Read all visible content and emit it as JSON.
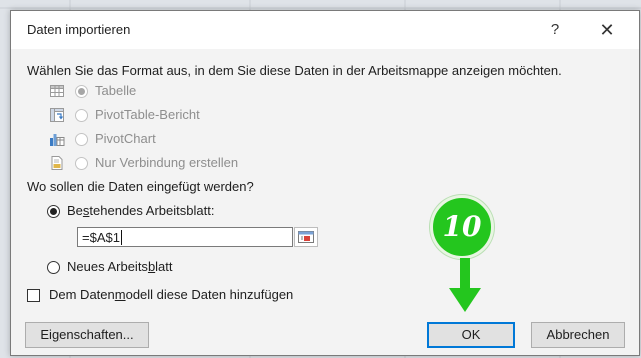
{
  "dialog": {
    "title": "Daten importieren",
    "help_glyph": "?",
    "close_glyph": "✕",
    "prompt_format": "Wählen Sie das Format aus, in dem Sie diese Daten in der Arbeitsmappe anzeigen möchten.",
    "format_options": [
      {
        "label": "Tabelle",
        "icon": "table-icon",
        "selected": true,
        "enabled": false
      },
      {
        "label": "PivotTable-Bericht",
        "icon": "pivottable-icon",
        "selected": false,
        "enabled": false
      },
      {
        "label": "PivotChart",
        "icon": "pivotchart-icon",
        "selected": false,
        "enabled": false
      },
      {
        "label": "Nur Verbindung erstellen",
        "icon": "connection-icon",
        "selected": false,
        "enabled": false
      }
    ],
    "prompt_location": "Wo sollen die Daten eingefügt werden?",
    "existing_sheet": {
      "pre": "Be",
      "ul": "s",
      "post": "tehendes Arbeitsblatt:",
      "selected": true
    },
    "range_value": "=$A$1",
    "new_sheet": {
      "pre": "Neues Arbeits",
      "ul": "b",
      "post": "latt",
      "selected": false
    },
    "datamodel": {
      "pre": "Dem Daten",
      "ul": "m",
      "post": "odell diese Daten hinzufügen",
      "checked": false
    },
    "properties_button": {
      "pre": "Ei",
      "ul": "g",
      "post": "enschaften..."
    },
    "ok_label": "OK",
    "cancel_label": "Abbrechen"
  },
  "annotation": {
    "step_number": "10",
    "color": "#24c61e"
  }
}
